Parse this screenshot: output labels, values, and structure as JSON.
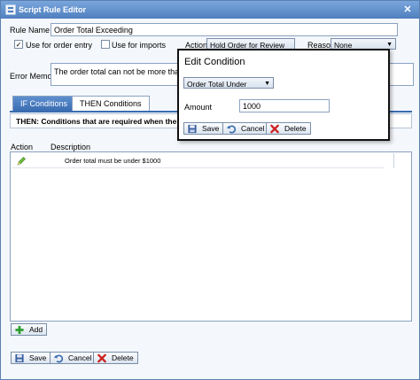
{
  "window": {
    "title": "Script Rule Editor",
    "close_glyph": "✕"
  },
  "form": {
    "rule_name_label": "Rule Name",
    "rule_name_value": "Order Total Exceeding",
    "use_for_order_entry_label": "Use for order entry",
    "use_for_order_entry_checked": true,
    "use_for_imports_label": "Use for imports",
    "use_for_imports_checked": false,
    "action_label": "Action",
    "action_value": "Hold Order for Review",
    "reason_label": "Reason",
    "reason_value": "None",
    "error_memo_label": "Error Memo",
    "error_memo_value": "The order total can not be more than $10"
  },
  "tabs": [
    {
      "label": "IF Conditions",
      "active": true
    },
    {
      "label": "THEN Conditions",
      "active": false
    }
  ],
  "then_note": "THEN: Conditions that are required when the condition",
  "grid": {
    "columns": [
      "Action",
      "Description"
    ],
    "rows": [
      {
        "icon": "pencil-icon",
        "description": "Order total must be under $1000"
      }
    ]
  },
  "buttons": {
    "add": "Add",
    "save": "Save",
    "cancel": "Cancel",
    "delete": "Delete"
  },
  "dialog": {
    "title": "Edit Condition",
    "condition_type": "Order Total Under",
    "amount_label": "Amount",
    "amount_value": "1000",
    "save": "Save",
    "cancel": "Cancel",
    "delete": "Delete"
  },
  "colors": {
    "titlebar": "#4f7fbf",
    "tab_active": "#3a6cb0",
    "add_icon": "#2e9e2e",
    "delete_icon": "#cc2222"
  }
}
